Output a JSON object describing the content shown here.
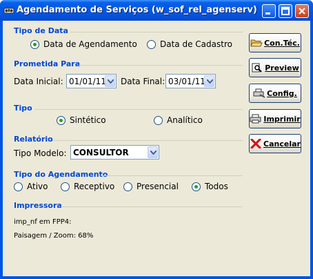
{
  "window": {
    "title": "Agendamento de Serviços (w_sof_rel_agenserv)",
    "title_buttons": [
      "minimize-icon",
      "maximize-icon",
      "close-icon"
    ]
  },
  "tipo_data": {
    "title": "Tipo de Data",
    "options": [
      {
        "label": "Data de Agendamento",
        "checked": true
      },
      {
        "label": "Data de Cadastro",
        "checked": false
      }
    ]
  },
  "prometida": {
    "title": "Prometida Para",
    "inicial_label": "Data Inicial:",
    "inicial_value": "01/01/11",
    "final_label": "Data Final:",
    "final_value": "03/01/11"
  },
  "tipo": {
    "title": "Tipo",
    "options": [
      {
        "label": "Sintético",
        "checked": true
      },
      {
        "label": "Analítico",
        "checked": false
      }
    ]
  },
  "relatorio": {
    "title": "Relatório",
    "modelo_label": "Tipo Modelo:",
    "modelo_value": "CONSULTOR"
  },
  "tipo_agendamento": {
    "title": "Tipo do Agendamento",
    "options": [
      {
        "label": "Ativo",
        "checked": false
      },
      {
        "label": "Receptivo",
        "checked": false
      },
      {
        "label": "Presencial",
        "checked": false
      },
      {
        "label": "Todos",
        "checked": true
      }
    ]
  },
  "impressora": {
    "title": "Impressora",
    "line1": "imp_nf em FPP4:",
    "line2": "Paisagem / Zoom: 68%"
  },
  "buttons": {
    "contec": "Con.Téc.",
    "preview": "Preview",
    "config": "Config.",
    "imprimir": "Imprimir",
    "cancelar": "Cancelar"
  },
  "colors": {
    "titlebar": "#0054e3",
    "group_title": "#0046d5",
    "client_bg": "#ece9d8",
    "radio_check": "#21a121"
  }
}
